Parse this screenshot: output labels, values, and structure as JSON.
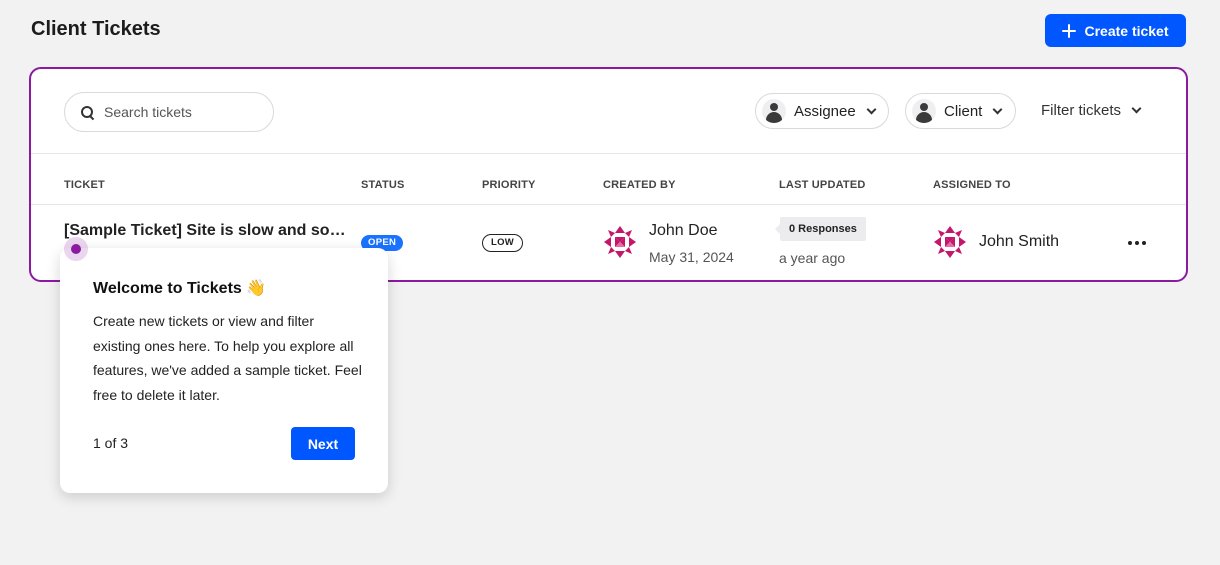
{
  "page": {
    "title": "Client Tickets"
  },
  "header": {
    "create_label": "Create ticket"
  },
  "filters": {
    "search_placeholder": "Search tickets",
    "assignee_label": "Assignee",
    "client_label": "Client",
    "filter_label": "Filter tickets"
  },
  "table": {
    "columns": [
      "TICKET",
      "STATUS",
      "PRIORITY",
      "CREATED BY",
      "LAST UPDATED",
      "ASSIGNED TO"
    ],
    "rows": [
      {
        "title": "[Sample Ticket] Site is slow and sometimes unresponsive",
        "status": "OPEN",
        "priority": "LOW",
        "created_by": "John Doe",
        "created_date": "May 31, 2024",
        "responses": "0 Responses",
        "last_updated": "a year ago",
        "assigned_to": "John Smith"
      }
    ]
  },
  "tour": {
    "title": "Welcome to Tickets 👋",
    "body": "Create new tickets or view and filter existing ones here. To help you explore all features, we've added a sample ticket. Feel free to delete it later.",
    "step": "1 of 3",
    "next_label": "Next"
  },
  "colors": {
    "accent": "#0057ff",
    "highlight": "#8a1aa0",
    "status_open": "#1a73ff",
    "avatar": "#c4176c"
  }
}
